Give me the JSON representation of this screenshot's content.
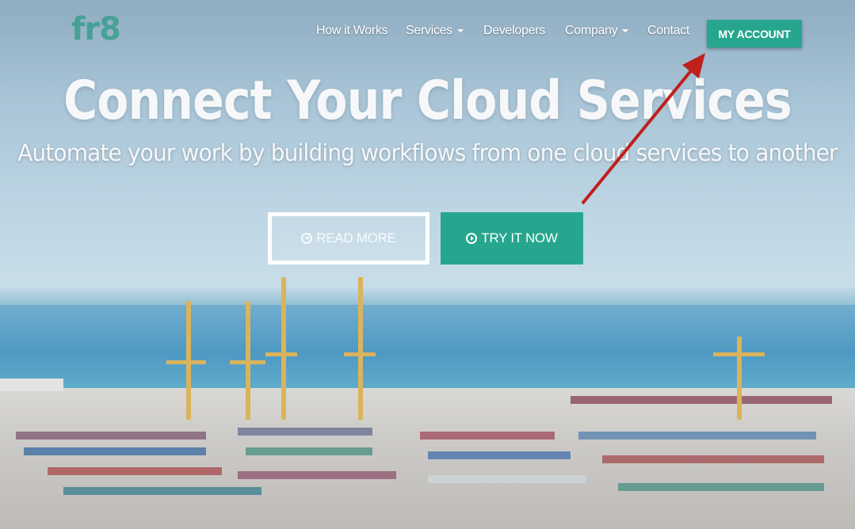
{
  "brand": {
    "logo_text": "fr8",
    "accent": "#26a68e"
  },
  "nav": {
    "items": [
      {
        "label": "How it Works",
        "dropdown": false
      },
      {
        "label": "Services",
        "dropdown": true
      },
      {
        "label": "Developers",
        "dropdown": false
      },
      {
        "label": "Company",
        "dropdown": true
      },
      {
        "label": "Contact",
        "dropdown": false
      }
    ],
    "account_label": "MY ACCOUNT"
  },
  "hero": {
    "title": "Connect Your Cloud Services",
    "subtitle": "Automate your work by building workflows from one cloud services to another",
    "read_more_label": "READ MORE",
    "read_more_icon": "circle-arrow-down-icon",
    "try_label": "TRY IT NOW",
    "try_icon": "circle-arrow-right-icon"
  },
  "annotation": {
    "color": "#c0201c",
    "points_to": "account-button"
  }
}
